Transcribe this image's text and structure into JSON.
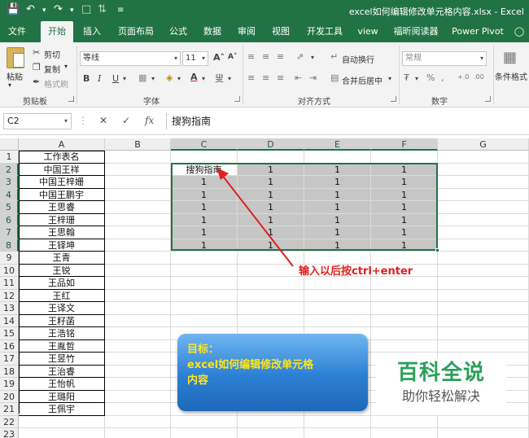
{
  "window": {
    "title": "excel如何编辑修改单元格内容.xlsx - Excel"
  },
  "ribbon": {
    "tabs": [
      "文件",
      "开始",
      "插入",
      "页面布局",
      "公式",
      "数据",
      "审阅",
      "视图",
      "开发工具",
      "view",
      "福昕阅读器",
      "Power Pivot"
    ],
    "active_tab": "开始",
    "clipboard": {
      "paste": "粘贴",
      "cut": "剪切",
      "copy": "复制",
      "format_painter": "格式刷",
      "group": "剪贴板"
    },
    "font": {
      "name": "等线",
      "size": "11",
      "group": "字体"
    },
    "alignment": {
      "wrap": "自动换行",
      "merge": "合并后居中",
      "group": "对齐方式"
    },
    "number": {
      "format": "常规",
      "group": "数字"
    },
    "styles": {
      "conditional": "条件格式"
    }
  },
  "formula_bar": {
    "name_box": "C2",
    "content": "搜狗指南"
  },
  "sheet": {
    "columns": [
      "A",
      "B",
      "C",
      "D",
      "E",
      "F",
      "G"
    ],
    "rows": [
      "1",
      "2",
      "3",
      "4",
      "5",
      "6",
      "7",
      "8",
      "9",
      "10",
      "11",
      "12",
      "13",
      "14",
      "15",
      "16",
      "17",
      "18",
      "19",
      "20",
      "21",
      "22",
      "23"
    ],
    "colA": [
      "工作表名",
      "中国王祥",
      "中国王梓姗",
      "中国王鹏宇",
      "王思睿",
      "王梓珊",
      "王思翰",
      "王铎坤",
      "王青",
      "王锐",
      "王品如",
      "王红",
      "王译文",
      "王籽菡",
      "王浩铭",
      "王胤哲",
      "王昱竹",
      "王治睿",
      "王怡帆",
      "王璐阳",
      "王佩宇",
      "",
      ""
    ],
    "block": [
      [
        "搜狗指南",
        "1",
        "1",
        "1"
      ],
      [
        "1",
        "1",
        "1",
        "1"
      ],
      [
        "1",
        "1",
        "1",
        "1"
      ],
      [
        "1",
        "1",
        "1",
        "1"
      ],
      [
        "1",
        "1",
        "1",
        "1"
      ],
      [
        "1",
        "1",
        "1",
        "1"
      ],
      [
        "1",
        "1",
        "1",
        "1"
      ]
    ]
  },
  "annotation": {
    "instruction": "输入以后按ctrl+enter",
    "color": "#e01f1f",
    "goal_line1": "目标：",
    "goal_line2": "excel如何编辑修改单元格",
    "goal_line3": "内容"
  },
  "watermark": {
    "title": "百科全说",
    "subtitle": "助你轻松解决"
  },
  "colors": {
    "excel_green": "#217346",
    "selection_fill": "#c6c6c6"
  }
}
